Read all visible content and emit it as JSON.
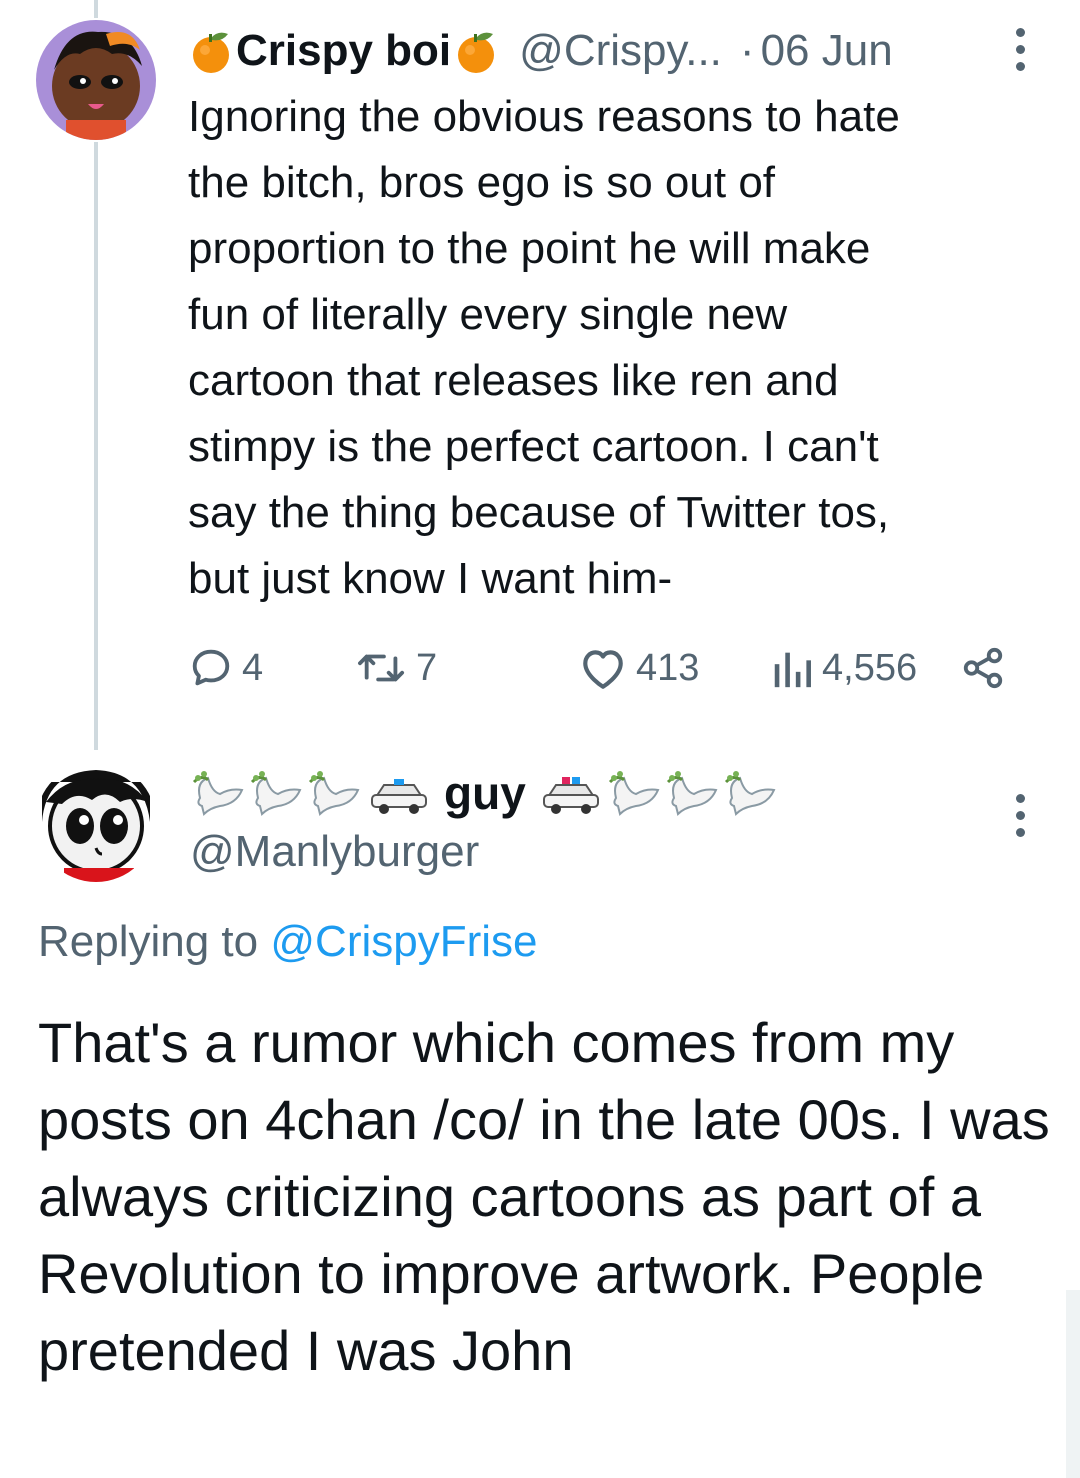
{
  "thread_tweet": {
    "display_name": "Crispy boi",
    "handle": "@Crispy...",
    "dot": "·",
    "date": "06 Jun",
    "text": "Ignoring the obvious reasons to hate\nthe bitch, bros ego is so out of\nproportion to the point he will make\nfun of literally every single new\ncartoon that releases like ren and\nstimpy is the perfect cartoon. I can't\nsay the thing because of Twitter tos,\nbut just know I want him-",
    "stats": {
      "replies": "4",
      "retweets": "7",
      "likes": "413",
      "views": "4,556"
    },
    "icons": {
      "name_prefix": "tangerine-emoji",
      "name_suffix": "tangerine-emoji",
      "menu": "more-vertical-icon",
      "reply": "comment-icon",
      "retweet": "retweet-icon",
      "like": "heart-icon",
      "views": "views-chart-icon",
      "share": "share-icon"
    }
  },
  "focused_tweet": {
    "display_name_text": "guy",
    "display_name_emojis": [
      "dove-emoji",
      "dove-emoji",
      "dove-emoji",
      "police-car-emoji",
      "police-car-emoji",
      "dove-emoji",
      "dove-emoji",
      "dove-emoji"
    ],
    "handle": "@Manlyburger",
    "replying_to_label": "Replying to",
    "replying_to_mention": "@CrispyFrise",
    "text": "That's a rumor which comes from my posts on 4chan /co/ in the late 00s. I was always criticizing cartoons as part of a Revolution to improve artwork. People pretended I was John"
  },
  "colors": {
    "text_primary": "#0f1419",
    "text_secondary": "#536471",
    "link": "#1d9bf0",
    "thread_line": "#cfd9de"
  }
}
